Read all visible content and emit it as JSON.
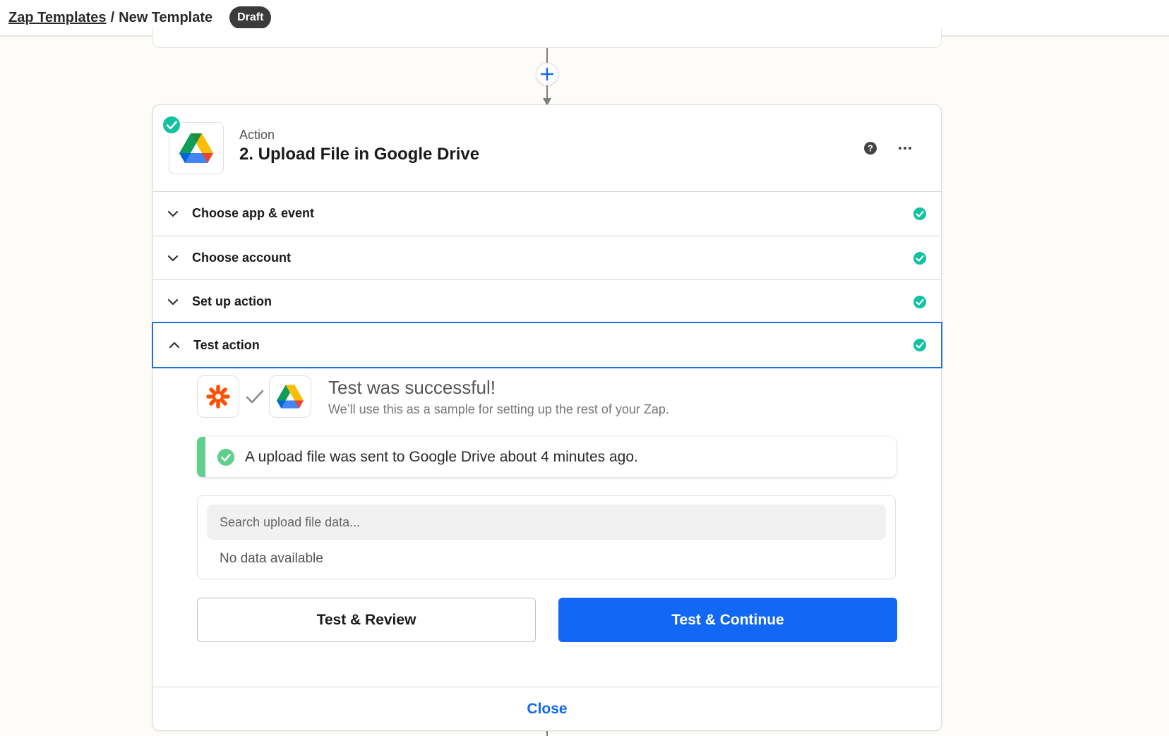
{
  "breadcrumb": {
    "link": "Zap Templates",
    "separator": "/",
    "current": "New Template",
    "badge": "Draft"
  },
  "step": {
    "kicker": "Action",
    "title": "2. Upload File in Google Drive",
    "icons": [
      "help-icon",
      "more-icon"
    ],
    "sections": [
      {
        "label": "Choose app & event",
        "expanded": false,
        "complete": true
      },
      {
        "label": "Choose account",
        "expanded": false,
        "complete": true
      },
      {
        "label": "Set up action",
        "expanded": false,
        "complete": true
      },
      {
        "label": "Test action",
        "expanded": true,
        "complete": true
      }
    ]
  },
  "test": {
    "title": "Test was successful!",
    "subtitle": "We’ll use this as a sample for setting up the rest of your Zap.",
    "notice": "A upload file was sent to Google Drive about 4 minutes ago.",
    "search_placeholder": "Search upload file data...",
    "empty_text": "No data available",
    "review_label": "Test & Review",
    "continue_label": "Test & Continue"
  },
  "footer": {
    "close_label": "Close"
  },
  "colors": {
    "accent": "#1268f5",
    "success": "#13c2a3",
    "notice_bar": "#5fcf8d",
    "badge_bg": "#3b3b3b"
  }
}
